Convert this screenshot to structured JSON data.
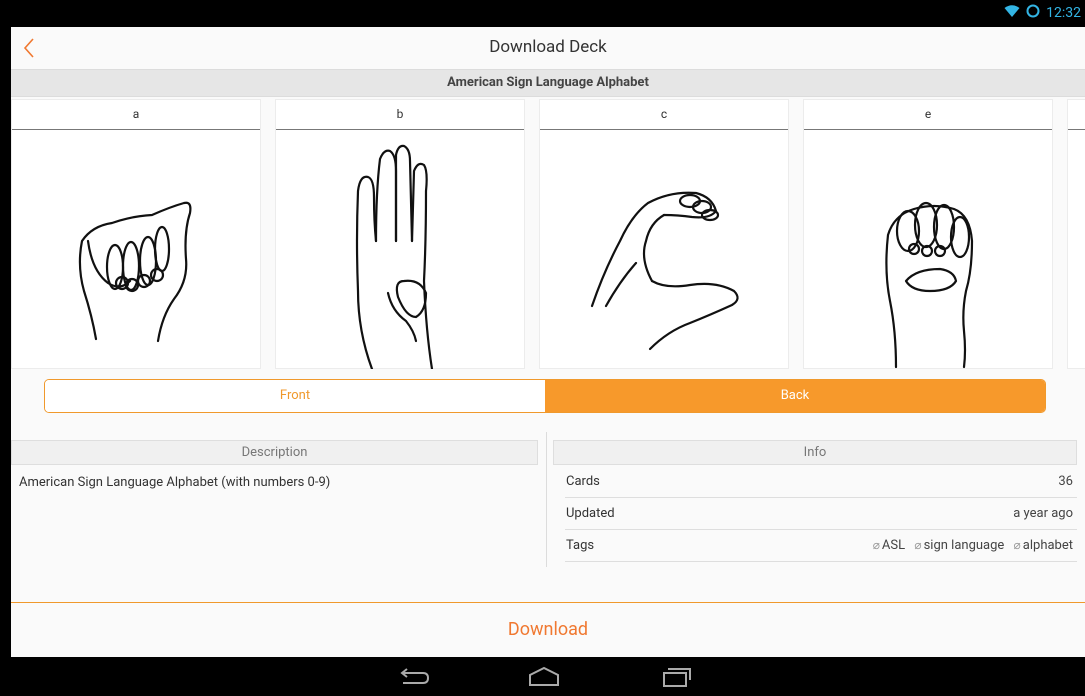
{
  "status": {
    "time": "12:32",
    "icons": [
      "wifi-icon",
      "sync-icon"
    ]
  },
  "header": {
    "title": "Download Deck",
    "back_icon": "chevron-left-icon"
  },
  "deck": {
    "name": "American Sign Language Alphabet"
  },
  "cards": [
    {
      "label": "a",
      "image": "asl-hand-a"
    },
    {
      "label": "b",
      "image": "asl-hand-b"
    },
    {
      "label": "c",
      "image": "asl-hand-c"
    },
    {
      "label": "e",
      "image": "asl-hand-e"
    }
  ],
  "toggle": {
    "front": "Front",
    "back": "Back",
    "selected": "Back"
  },
  "description": {
    "heading": "Description",
    "text": "American Sign Language Alphabet (with numbers 0-9)"
  },
  "info": {
    "heading": "Info",
    "rows": [
      {
        "key": "Cards",
        "value": "36"
      },
      {
        "key": "Updated",
        "value": "a year ago"
      },
      {
        "key": "Tags",
        "tags": [
          "ASL",
          "sign language",
          "alphabet"
        ]
      }
    ]
  },
  "download_label": "Download",
  "colors": {
    "accent": "#f7992b",
    "download_text": "#f07830",
    "status_blue": "#33b5e5"
  },
  "nav": [
    "back-icon",
    "home-icon",
    "recent-apps-icon"
  ]
}
